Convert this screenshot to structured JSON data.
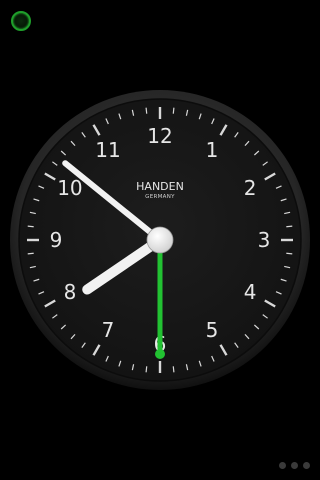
{
  "clock": {
    "brand": "HANDEN",
    "brand_sub": "GERMANY",
    "numerals": [
      "12",
      "1",
      "2",
      "3",
      "4",
      "5",
      "6",
      "7",
      "8",
      "9",
      "10",
      "11"
    ],
    "time": {
      "hours": 7,
      "minutes": 51.5,
      "seconds": 30
    },
    "colors": {
      "face": "#191919",
      "bezel": "#2c2c2c",
      "numerals": "#e6e6e6",
      "hands": "#f2f2f2",
      "second_hand": "#22c232"
    }
  },
  "status_indicator": {
    "color": "#1f9f2b"
  },
  "pager": {
    "count": 3
  }
}
